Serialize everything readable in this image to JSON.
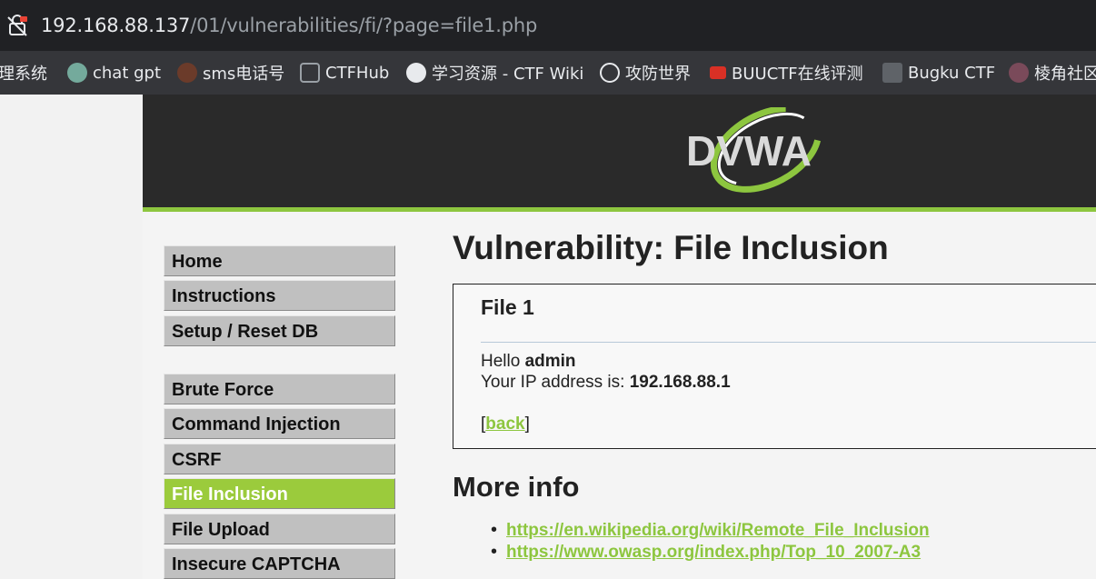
{
  "browser": {
    "url_host": "192.168.88.137",
    "url_path": "/01/vulnerabilities/fi/?page=file1.php",
    "bookmarks": [
      {
        "label": "理系统",
        "icon": "none"
      },
      {
        "label": "chat gpt",
        "icon": "chatgpt-icon",
        "color": "#74aa9c"
      },
      {
        "label": "sms电话号",
        "icon": "sms-icon",
        "color": "#6b3b2a"
      },
      {
        "label": "CTFHub",
        "icon": "ctfhub-icon",
        "color": "#9aa0a6"
      },
      {
        "label": "学习资源 - CTF Wiki",
        "icon": "ctfwiki-icon",
        "color": "#e8eaed"
      },
      {
        "label": "攻防世界",
        "icon": "globe-icon",
        "color": "#e8eaed"
      },
      {
        "label": "BUUCTF在线评测",
        "icon": "buuctf-icon",
        "color": "#d93025"
      },
      {
        "label": "Bugku CTF",
        "icon": "bugku-icon",
        "color": "#5f6368"
      },
      {
        "label": "棱角社区",
        "icon": "lengjiao-icon",
        "color": "#7a4a5a"
      }
    ]
  },
  "header": {
    "logo_text": "DVWA",
    "brand_color": "#8dc63f",
    "bg_color": "#2a2a2a"
  },
  "menu": {
    "items": [
      {
        "label": "Home",
        "active": false
      },
      {
        "label": "Instructions",
        "active": false
      },
      {
        "label": "Setup / Reset DB",
        "active": false
      },
      {
        "label": "Brute Force",
        "active": false
      },
      {
        "label": "Command Injection",
        "active": false
      },
      {
        "label": "CSRF",
        "active": false
      },
      {
        "label": "File Inclusion",
        "active": true
      },
      {
        "label": "File Upload",
        "active": false
      },
      {
        "label": "Insecure CAPTCHA",
        "active": false
      }
    ]
  },
  "main": {
    "title": "Vulnerability: File Inclusion",
    "file_box": {
      "heading": "File 1",
      "hello_prefix": "Hello ",
      "hello_user": "admin",
      "ip_prefix": "Your IP address is: ",
      "ip_value": "192.168.88.1",
      "back_open": "[",
      "back_label": "back",
      "back_close": "]"
    },
    "more_info_title": "More info",
    "links": [
      "https://en.wikipedia.org/wiki/Remote_File_Inclusion",
      "https://www.owasp.org/index.php/Top_10_2007-A3"
    ]
  }
}
